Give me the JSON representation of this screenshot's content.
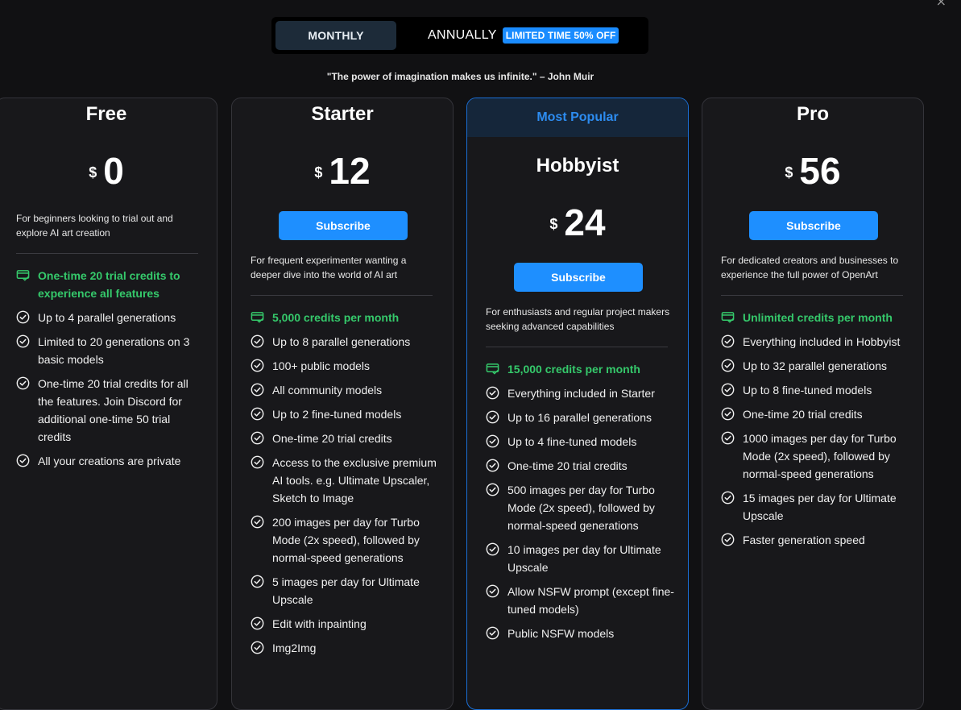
{
  "window": {
    "close_glyph": "×"
  },
  "billing_toggle": {
    "monthly_label": "MONTHLY",
    "annually_label": "ANNUALLY",
    "badge": "LIMITED TIME 50% OFF"
  },
  "quote": "\"The power of imagination makes us infinite.\" – John Muir",
  "colors": {
    "accent": "#1e8fff",
    "credit_green": "#35c96b",
    "background": "#111113",
    "card": "#18181b"
  },
  "plans": [
    {
      "name": "Free",
      "currency": "$",
      "price": "0",
      "description": "For beginners looking to trial out and explore AI art creation",
      "features": [
        {
          "text": "One-time 20 trial credits to experience all features",
          "credit": true
        },
        {
          "text": "Up to 4 parallel generations"
        },
        {
          "text": "Limited to 20 generations on 3 basic models"
        },
        {
          "text": "One-time 20 trial credits for all the features. Join Discord for additional one-time 50 trial credits"
        },
        {
          "text": "All your creations are private"
        }
      ]
    },
    {
      "name": "Starter",
      "currency": "$",
      "price": "12",
      "subscribe_label": "Subscribe",
      "description": "For frequent experimenter wanting a deeper dive into the world of AI art",
      "features": [
        {
          "text": "5,000  credits  per month",
          "credit": true
        },
        {
          "text": "Up to 8 parallel generations"
        },
        {
          "text": "100+ public models"
        },
        {
          "text": "All community models"
        },
        {
          "text": "Up to 2 fine-tuned models"
        },
        {
          "text": "One-time 20 trial credits"
        },
        {
          "text": "Access to the exclusive premium AI tools. e.g. Ultimate Upscaler, Sketch to Image"
        },
        {
          "text": "200 images per day for Turbo Mode (2x speed), followed by normal-speed generations"
        },
        {
          "text": "5 images per day for Ultimate Upscale"
        },
        {
          "text": "Edit with inpainting"
        },
        {
          "text": "Img2Img"
        }
      ]
    },
    {
      "name": "Hobbyist",
      "banner": "Most Popular",
      "currency": "$",
      "price": "24",
      "subscribe_label": "Subscribe",
      "description": "For enthusiasts and regular project makers seeking advanced capabilities",
      "features": [
        {
          "text": "15,000  credits  per month",
          "credit": true
        },
        {
          "text": "Everything included in Starter"
        },
        {
          "text": "Up to 16 parallel generations"
        },
        {
          "text": "Up to 4 fine-tuned models"
        },
        {
          "text": "One-time 20 trial credits"
        },
        {
          "text": "500 images per day for Turbo Mode (2x speed), followed by normal-speed generations"
        },
        {
          "text": "10 images per day for Ultimate Upscale"
        },
        {
          "text": "Allow NSFW prompt (except fine-tuned models)"
        },
        {
          "text": "Public NSFW models"
        }
      ]
    },
    {
      "name": "Pro",
      "currency": "$",
      "price": "56",
      "subscribe_label": "Subscribe",
      "description": "For dedicated creators and businesses to experience the full power of OpenArt",
      "features": [
        {
          "text": "Unlimited  credits  per month",
          "credit": true
        },
        {
          "text": "Everything included in Hobbyist"
        },
        {
          "text": "Up to 32 parallel generations"
        },
        {
          "text": "Up to 8 fine-tuned models"
        },
        {
          "text": "One-time 20 trial credits"
        },
        {
          "text": "1000 images per day for Turbo Mode (2x speed), followed by normal-speed generations"
        },
        {
          "text": "15 images per day for Ultimate Upscale"
        },
        {
          "text": "Faster generation speed"
        }
      ]
    }
  ]
}
